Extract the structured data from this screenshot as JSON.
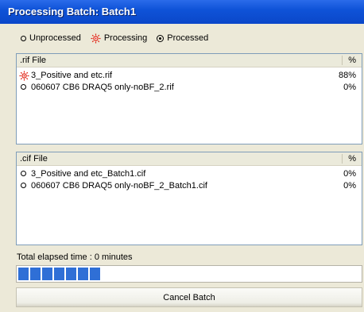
{
  "window": {
    "title": "Processing Batch: Batch1"
  },
  "legend": {
    "unprocessed": "Unprocessed",
    "processing": "Processing",
    "processed": "Processed"
  },
  "rif_panel": {
    "header_name": ".rif File",
    "header_pct": "%",
    "rows": [
      {
        "status": "processing",
        "name": "3_Positive and etc.rif",
        "pct": "88%"
      },
      {
        "status": "unprocessed",
        "name": "060607 CB6 DRAQ5 only-noBF_2.rif",
        "pct": "0%"
      }
    ]
  },
  "cif_panel": {
    "header_name": ".cif File",
    "header_pct": "%",
    "rows": [
      {
        "status": "unprocessed",
        "name": "3_Positive and etc_Batch1.cif",
        "pct": "0%"
      },
      {
        "status": "unprocessed",
        "name": "060607 CB6 DRAQ5 only-noBF_2_Batch1.cif",
        "pct": "0%"
      }
    ]
  },
  "status": {
    "elapsed_text": "Total elapsed time : 0 minutes"
  },
  "progress": {
    "fraction": 0.25,
    "color": "#2f6fd6"
  },
  "buttons": {
    "cancel_label": "Cancel Batch"
  },
  "colors": {
    "title_bar": "#0f53d8",
    "processing_icon": "#e02010"
  }
}
